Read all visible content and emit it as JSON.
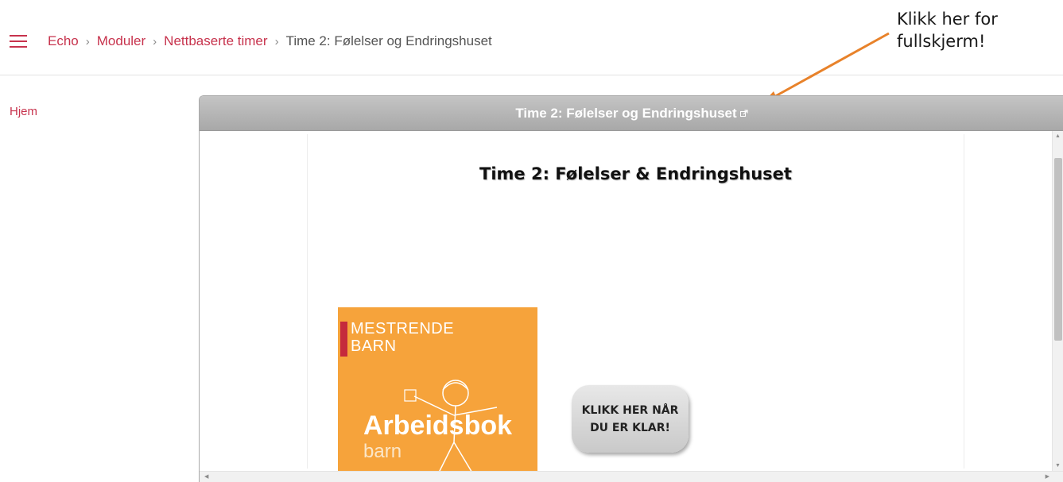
{
  "breadcrumb": {
    "items": [
      "Echo",
      "Moduler",
      "Nettbaserte timer"
    ],
    "current": "Time 2: Følelser og Endringshuset",
    "separator": "›"
  },
  "annotation": {
    "line1": "Klikk her for",
    "line2": "fullskjerm!"
  },
  "sidebar": {
    "home": "Hjem"
  },
  "panel": {
    "title": "Time 2: Følelser og Endringshuset"
  },
  "content": {
    "title": "Time 2: Følelser & Endringshuset",
    "book": {
      "line1": "MESTRENDE",
      "line2": "BARN",
      "big": "Arbeidsbok",
      "sub": "barn"
    },
    "button": {
      "line1": "KLIKK HER NÅR",
      "line2": "DU ER KLAR!"
    }
  },
  "colors": {
    "accent": "#c7334d",
    "arrow": "#e8822a",
    "book": "#f6a33b"
  }
}
